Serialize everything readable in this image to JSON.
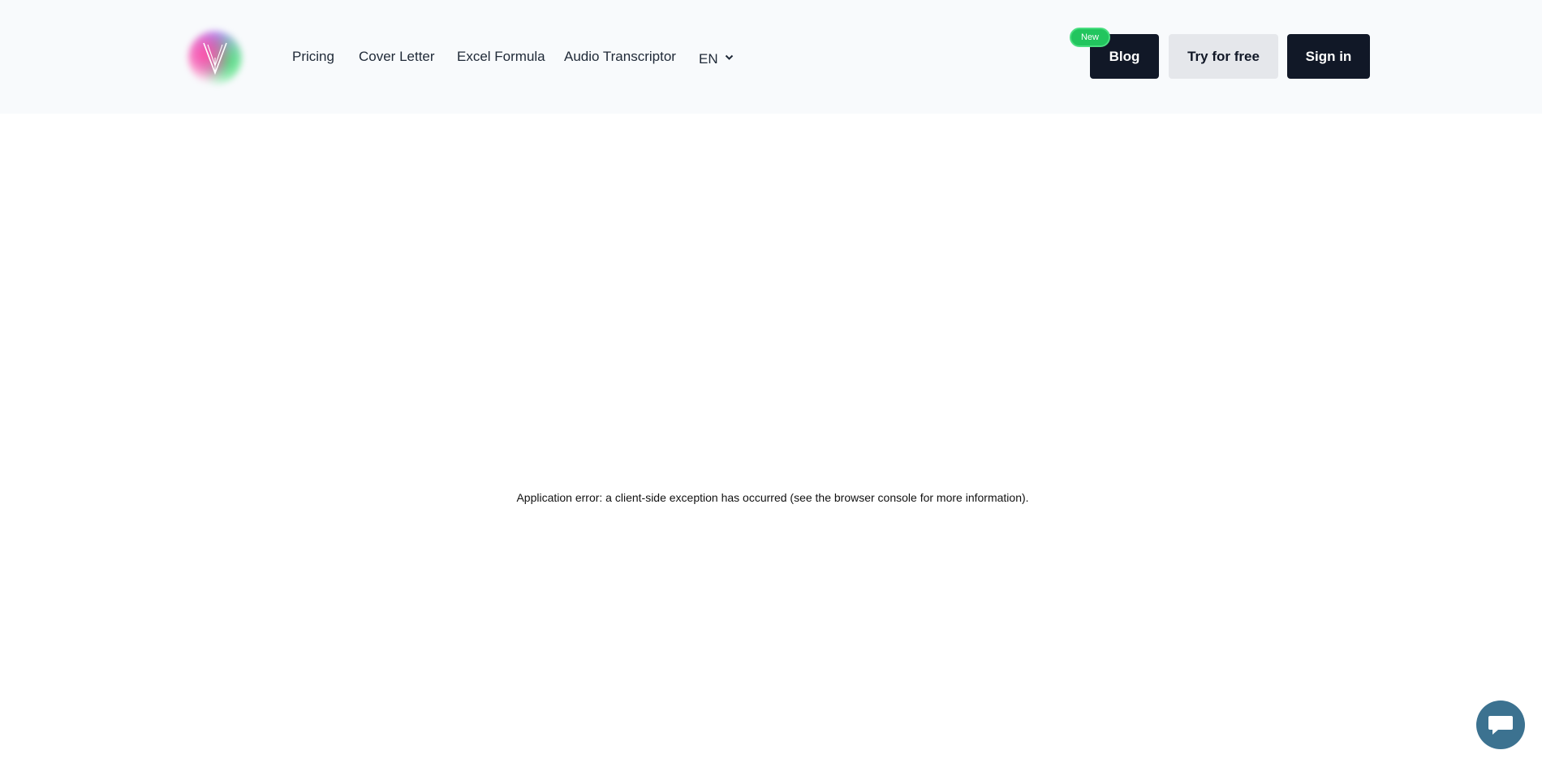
{
  "header": {
    "logo_name": "brand-logo",
    "nav": [
      {
        "label": "Pricing"
      },
      {
        "label": "Cover Letter"
      },
      {
        "label": "Excel Formula"
      },
      {
        "label": "Audio Transcriptor"
      }
    ],
    "language": "EN",
    "new_badge": "New",
    "blog_label": "Blog",
    "try_label": "Try for free",
    "signin_label": "Sign in"
  },
  "main": {
    "error_message": "Application error: a client-side exception has occurred (see the browser console for more information)."
  },
  "chat": {
    "icon": "chat-icon"
  },
  "colors": {
    "header_bg": "#f8fafc",
    "dark_button": "#111827",
    "light_button": "#e5e7eb",
    "badge_green": "#22c55e",
    "chat_bubble": "#3c7290"
  }
}
